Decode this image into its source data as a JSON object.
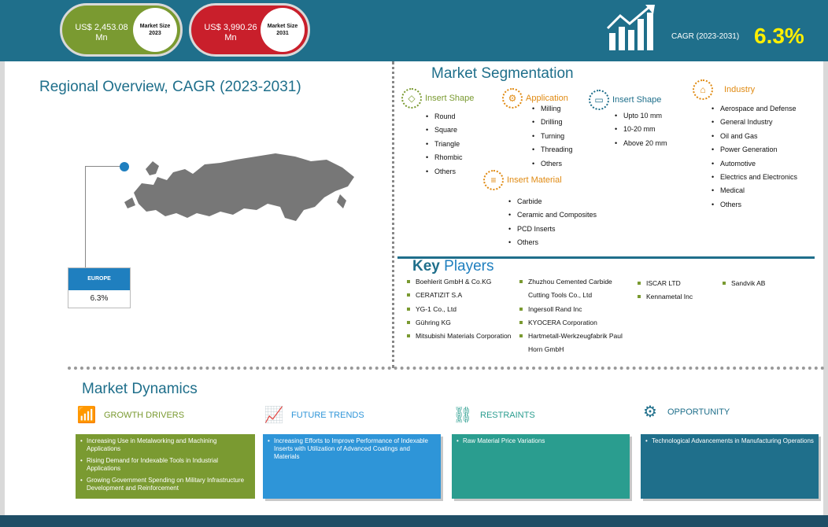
{
  "header": {
    "market_2023": {
      "value": "US$ 2,453.08 Mn",
      "label_line1": "Market Size",
      "label_line2": "2023"
    },
    "market_2031": {
      "value": "US$ 3,990.26 Mn",
      "label_line1": "Market Size",
      "label_line2": "2031"
    },
    "cagr_label": "CAGR (2023-2031)",
    "cagr_value": "6.3%",
    "colors": {
      "header_bg": "#1f6f8b",
      "green": "#7a9a31",
      "red": "#c91f2b",
      "cagr_value": "#ffef00"
    }
  },
  "regional": {
    "title": "Regional Overview, CAGR (2023-2031)",
    "region_name": "EUROPE",
    "region_cagr": "6.3%"
  },
  "segmentation": {
    "title": "Market Segmentation",
    "groups": [
      {
        "title": "Insert Shape",
        "color": "#7a9a31",
        "icon": "diamond-shape-icon",
        "items": [
          "Round",
          "Square",
          "Triangle",
          "Rhombic",
          "Others"
        ]
      },
      {
        "title": "Application",
        "color": "#e08a12",
        "icon": "cog-application-icon",
        "items": [
          "Milling",
          "Drilling",
          "Turning",
          "Threading",
          "Others"
        ]
      },
      {
        "title": "Insert Shape",
        "color": "#1f6f8b",
        "icon": "size-ruler-icon",
        "items": [
          "Upto 10 mm",
          "10-20 mm",
          "Above 20 mm"
        ]
      },
      {
        "title": "Industry",
        "color": "#e08a12",
        "icon": "factory-icon",
        "items": [
          "Aerospace and Defense",
          "General Industry",
          "Oil and Gas",
          "Power Generation",
          "Automotive",
          "Electrics and Electronics",
          "Medical",
          "Others"
        ]
      },
      {
        "title": "Insert Material",
        "color": "#e08a12",
        "icon": "material-layers-icon",
        "items": [
          "Carbide",
          "Ceramic and Composites",
          "PCD Inserts",
          "Others"
        ]
      }
    ]
  },
  "key_players": {
    "title_key": "Key",
    "title_players": "Players",
    "columns": [
      [
        "Boehlerit GmbH & Co.KG",
        "CERATIZIT S.A",
        "YG-1 Co., Ltd",
        "Gühring KG",
        "Mitsubishi Materials Corporation"
      ],
      [
        "Zhuzhou Cemented Carbide Cutting Tools Co., Ltd",
        "Ingersoll Rand Inc",
        "KYOCERA Corporation",
        "Hartmetall-Werkzeugfabrik Paul Horn GmbH"
      ],
      [
        "ISCAR LTD",
        "Kennametal Inc"
      ],
      [
        "Sandvik AB"
      ]
    ]
  },
  "dynamics": {
    "title": "Market Dynamics",
    "sections": [
      {
        "title": "GROWTH DRIVERS",
        "color": "#7a9a31",
        "icon": "bar-chart-icon",
        "items": [
          "Increasing Use in Metalworking and Machining Applications",
          "Rising Demand for Indexable Tools in Industrial Applications",
          "Growing Government Spending on Military Infrastructure Development and Reinforcement"
        ]
      },
      {
        "title": "FUTURE TRENDS",
        "color": "#2e95d8",
        "icon": "trend-chart-icon",
        "items": [
          "Increasing Efforts to Improve Performance of Indexable Inserts with Utilization of Advanced Coatings and Materials"
        ]
      },
      {
        "title": "RESTRAINTS",
        "color": "#2a9d8f",
        "icon": "chain-link-icon",
        "items": [
          "Raw Material Price Variations"
        ]
      },
      {
        "title": "OPPORTUNITY",
        "color": "#1f6f8b",
        "icon": "gear-icon",
        "items": [
          "Technological Advancements in Manufacturing Operations"
        ]
      }
    ]
  }
}
